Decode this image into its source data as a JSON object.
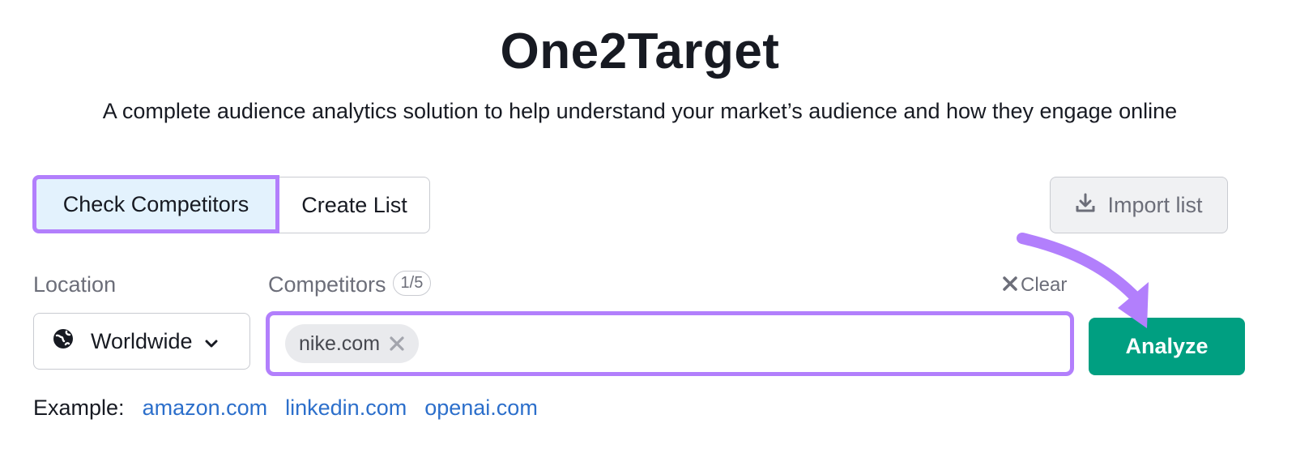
{
  "header": {
    "title": "One2Target",
    "subtitle": "A complete audience analytics solution to help understand your market’s audience and how they engage online"
  },
  "tabs": [
    {
      "label": "Check Competitors",
      "active": true
    },
    {
      "label": "Create List",
      "active": false
    }
  ],
  "import_button": {
    "label": "Import list",
    "icon": "download-icon"
  },
  "location": {
    "label": "Location",
    "selected": "Worldwide",
    "icon": "globe-icon"
  },
  "competitors": {
    "label": "Competitors",
    "count": "1/5",
    "clear_label": "Clear",
    "chips": [
      "nike.com"
    ]
  },
  "analyze_button": {
    "label": "Analyze"
  },
  "examples": {
    "label": "Example:",
    "links": [
      "amazon.com",
      "linkedin.com",
      "openai.com"
    ]
  },
  "colors": {
    "highlight": "#b27ffc",
    "primary": "#009f81",
    "link": "#2c6fcb",
    "active_tab_bg": "#e3f2fd"
  }
}
